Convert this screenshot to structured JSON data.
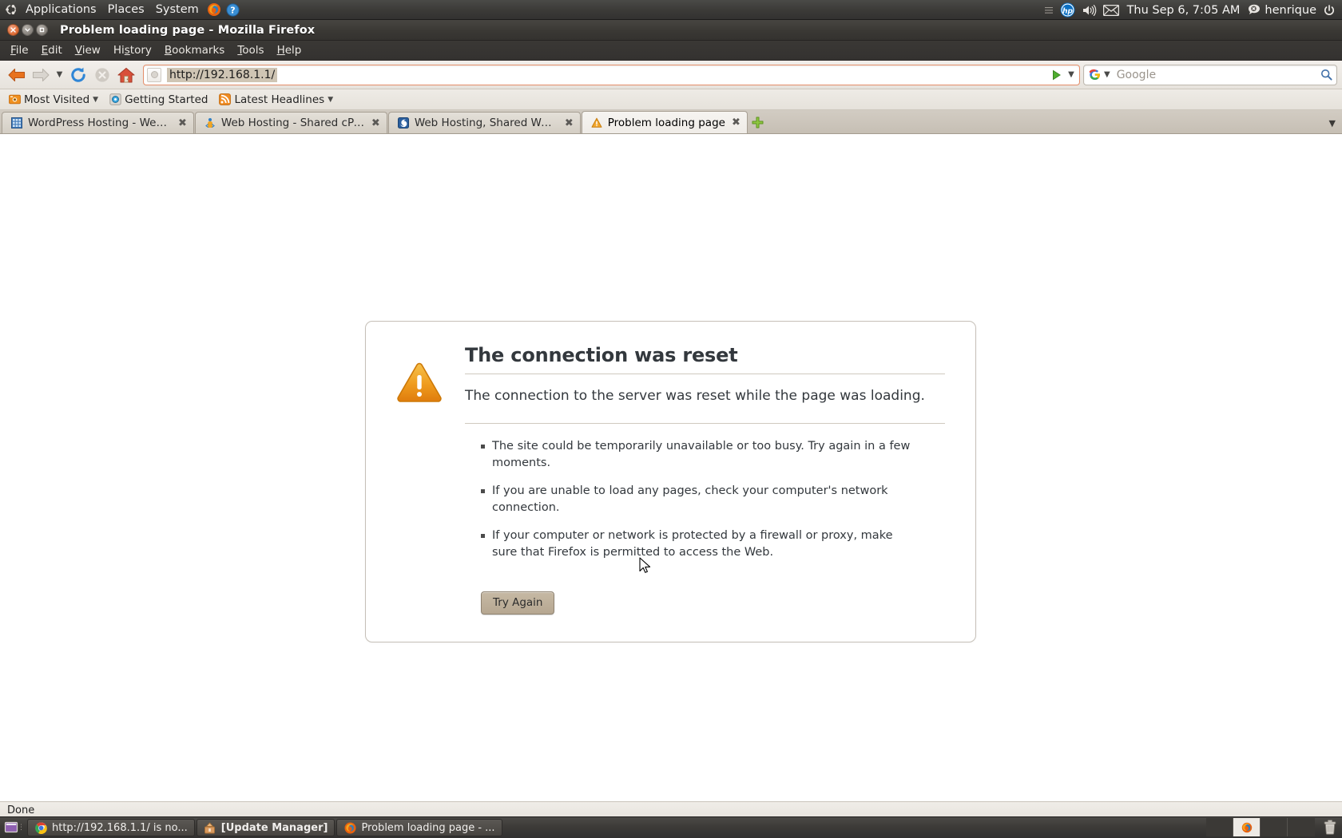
{
  "desktop": {
    "panel": {
      "logo_icon": "ubuntu-logo-icon",
      "menus": [
        {
          "label": "Applications",
          "name": "menu-applications"
        },
        {
          "label": "Places",
          "name": "menu-places"
        },
        {
          "label": "System",
          "name": "menu-system"
        }
      ],
      "launchers": [
        {
          "icon": "firefox-icon",
          "name": "panel-launcher-firefox"
        },
        {
          "icon": "help-icon",
          "name": "panel-launcher-help"
        }
      ],
      "tray": {
        "indicator_icon": "hp-indicator-icon",
        "volume_icon": "volume-icon",
        "mail_icon": "mail-envelope-icon",
        "clock": "Thu Sep  6,  7:05 AM",
        "user_status_icon": "user-status-offline-icon",
        "username": "henrique",
        "power_icon": "power-icon"
      }
    },
    "taskbar": {
      "show_desktop_icon": "show-desktop-icon",
      "tasks": [
        {
          "label": "http://192.168.1.1/ is no...",
          "icon": "chrome-icon",
          "bold": false,
          "name": "task-chrome"
        },
        {
          "label": "[Update Manager]",
          "icon": "update-manager-icon",
          "bold": true,
          "name": "task-update-manager"
        },
        {
          "label": "Problem loading page - ...",
          "icon": "firefox-icon",
          "bold": false,
          "name": "task-firefox"
        }
      ],
      "workspaces": [
        {
          "active": false,
          "name": "workspace-1"
        },
        {
          "active": true,
          "name": "workspace-2"
        },
        {
          "active": false,
          "name": "workspace-3"
        },
        {
          "active": false,
          "name": "workspace-4"
        }
      ],
      "trash_icon": "trash-icon"
    }
  },
  "browser": {
    "window_title": "Problem loading page - Mozilla Firefox",
    "window_buttons": {
      "close": "x",
      "minimize": "v",
      "maximize": "o"
    },
    "menubar": [
      {
        "label": "File",
        "accel": "F",
        "name": "menu-file"
      },
      {
        "label": "Edit",
        "accel": "E",
        "name": "menu-edit"
      },
      {
        "label": "View",
        "accel": "V",
        "name": "menu-view"
      },
      {
        "label": "History",
        "accel": "s",
        "name": "menu-history"
      },
      {
        "label": "Bookmarks",
        "accel": "B",
        "name": "menu-bookmarks"
      },
      {
        "label": "Tools",
        "accel": "T",
        "name": "menu-tools"
      },
      {
        "label": "Help",
        "accel": "H",
        "name": "menu-help"
      }
    ],
    "toolbar": {
      "back_icon": "back-arrow-icon",
      "forward_icon": "forward-arrow-icon",
      "history_dropdown_icon": "chevron-down-icon",
      "reload_icon": "reload-icon",
      "stop_icon": "stop-icon",
      "home_icon": "home-icon",
      "url": "http://192.168.1.1/",
      "go_icon": "go-arrow-icon",
      "urlbar_dropdown_icon": "chevron-down-icon",
      "search_engine": "Google",
      "search_engine_icon": "google-icon",
      "search_placeholder": "Google",
      "search_value": "",
      "search_icon": "magnifier-icon"
    },
    "bookmarks": [
      {
        "label": "Most Visited",
        "icon": "most-visited-icon",
        "caret": true,
        "name": "bookmark-most-visited"
      },
      {
        "label": "Getting Started",
        "icon": "getting-started-icon",
        "caret": false,
        "name": "bookmark-getting-started"
      },
      {
        "label": "Latest Headlines",
        "icon": "rss-feed-icon",
        "caret": true,
        "name": "bookmark-latest-headlines"
      }
    ],
    "tabs": [
      {
        "label": "WordPress Hosting - Web h...",
        "icon": "wordpress-favicon",
        "active": false,
        "name": "tab-wordpress-hosting"
      },
      {
        "label": "Web Hosting - Shared cPan...",
        "icon": "cpanel-favicon",
        "active": false,
        "name": "tab-web-hosting-cpanel"
      },
      {
        "label": "Web Hosting, Shared Web ...",
        "icon": "hosting-favicon",
        "active": false,
        "name": "tab-web-hosting-shared"
      },
      {
        "label": "Problem loading page",
        "icon": "warning-favicon",
        "active": true,
        "name": "tab-problem-loading-page"
      }
    ],
    "new_tab_icon": "plus-icon",
    "tab_list_caret_icon": "chevron-down-icon",
    "statusbar": "Done"
  },
  "page": {
    "warning_icon": "warning-triangle-icon",
    "title": "The connection was reset",
    "description": "The connection to the server was reset while the page was loading.",
    "suggestions": [
      "The site could be temporarily unavailable or too busy. Try again in a few moments.",
      "If you are unable to load any pages, check your computer's network connection.",
      "If your computer or network is protected by a firewall or proxy, make sure that Firefox is permitted to access the Web."
    ],
    "retry_button": "Try Again"
  },
  "colors": {
    "panel_bg": "#3a3835",
    "accent_orange": "#dd6b33",
    "urlbar_border": "#e58e6a",
    "url_selection": "#cfc5b4",
    "tab_active_bg": "#f6f4f1",
    "warning_amber": "#f0a32a",
    "button_tan": "#bdae97"
  }
}
